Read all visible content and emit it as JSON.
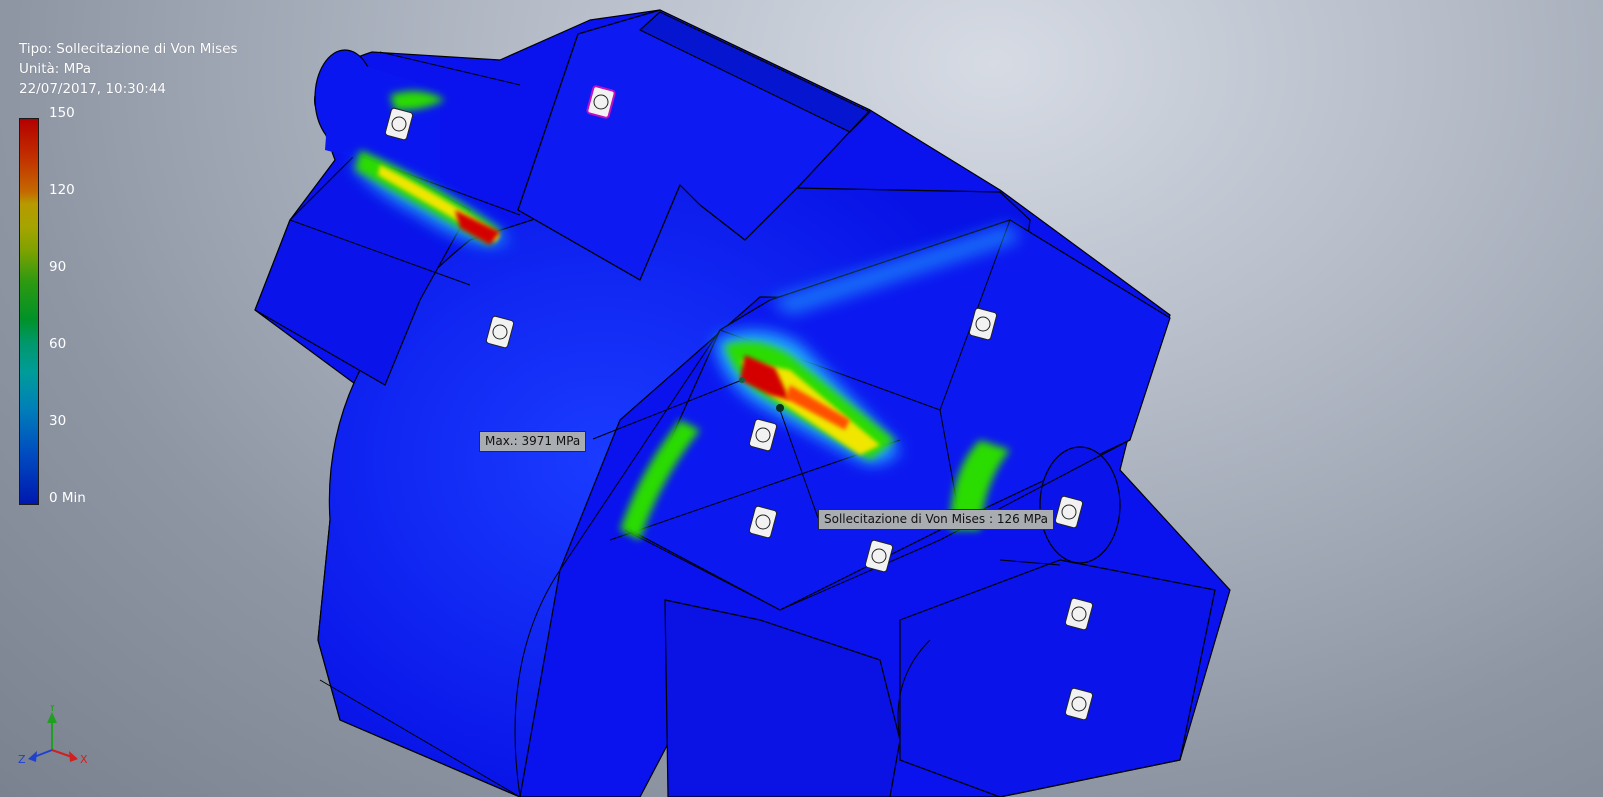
{
  "legend": {
    "type_line": "Tipo: Sollecitazione di Von Mises",
    "unit_line": "Unità: MPa",
    "timestamp": "22/07/2017, 10:30:44",
    "ticks": [
      "150",
      "120",
      "90",
      "60",
      "30",
      "0 Min"
    ]
  },
  "probes": {
    "max_label": "Max.: 3971 MPa",
    "point_label": "Sollecitazione di Von Mises : 126 MPa"
  },
  "triad": {
    "x_label": "X",
    "y_label": "Y",
    "z_label": "Z"
  },
  "colors": {
    "part_blue": "#0a14f0",
    "stress_high": "#d40000",
    "stress_mid": "#2cdc00",
    "x_axis": "#d02020",
    "y_axis": "#20a020",
    "z_axis": "#2040d0"
  }
}
